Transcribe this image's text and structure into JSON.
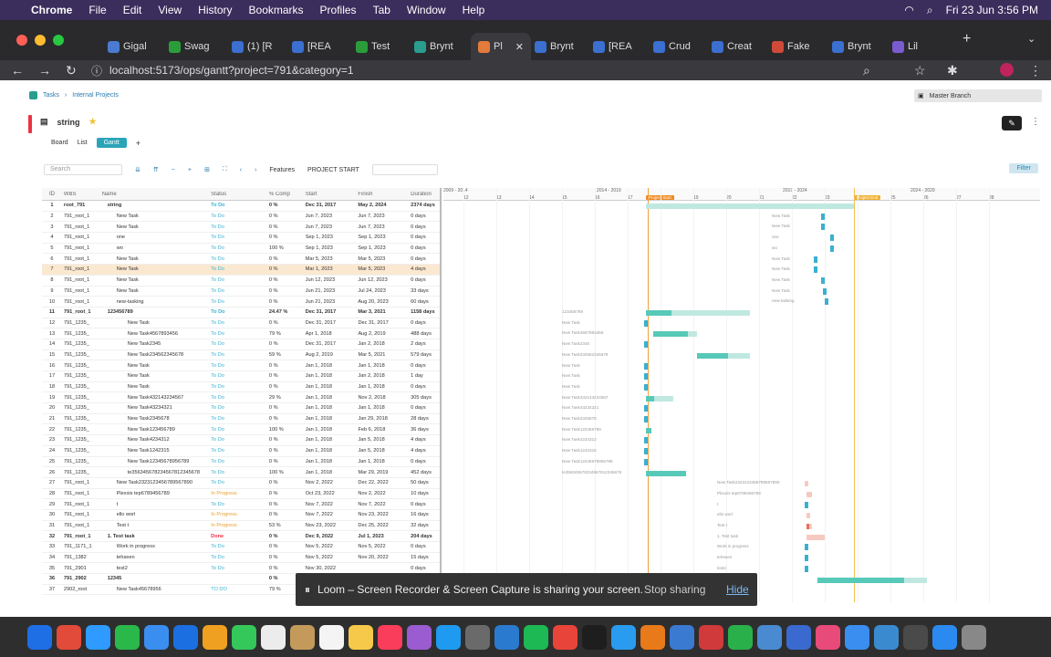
{
  "menubar": {
    "app": "Chrome",
    "menus": [
      "File",
      "Edit",
      "View",
      "History",
      "Bookmarks",
      "Profiles",
      "Tab",
      "Window",
      "Help"
    ],
    "clock": "Fri 23 Jun  3:56 PM"
  },
  "tabs": [
    {
      "label": "Gigal",
      "color": "#4a7bd0"
    },
    {
      "label": "Swag",
      "color": "#2a9d3a"
    },
    {
      "label": "(1) [R",
      "color": "#3b6fd0"
    },
    {
      "label": "[REA",
      "color": "#3b6fd0"
    },
    {
      "label": "Test",
      "color": "#2a9d3a"
    },
    {
      "label": "Brynt",
      "color": "#2a9d8f"
    },
    {
      "label": "Pl",
      "color": "#e37b3a",
      "active": true
    },
    {
      "label": "Brynt",
      "color": "#3b6fd0"
    },
    {
      "label": "[REA",
      "color": "#3b6fd0"
    },
    {
      "label": "Crud",
      "color": "#3b6fd0"
    },
    {
      "label": "Creat",
      "color": "#3b6fd0"
    },
    {
      "label": "Fake",
      "color": "#d04a3a"
    },
    {
      "label": "Brynt",
      "color": "#3b6fd0"
    },
    {
      "label": "Lil",
      "color": "#7a5cd0"
    }
  ],
  "address": {
    "url": "localhost:5173/ops/gantt?project=791&category=1"
  },
  "breadcrumb": {
    "root": "Tasks",
    "current": "Internal Projects"
  },
  "branch": "Master Branch",
  "project": {
    "title": "string"
  },
  "views": {
    "board": "Board",
    "list": "List",
    "gantt": "Gantt"
  },
  "toolbar": {
    "search_placeholder": "Search",
    "features": "Features",
    "project_start": "PROJECT START",
    "filter": "Filter"
  },
  "columns": {
    "id": "ID",
    "wbs": "WBS",
    "name": "Name",
    "status": "Status",
    "comp": "% Comp",
    "start": "Start",
    "finish": "Finish",
    "duration": "Duration"
  },
  "timeline": {
    "groups": [
      "2009 - 2014",
      "2014 - 2019",
      "2019 - 2024",
      "2024 - 2029"
    ],
    "ticks": [
      "12",
      "13",
      "14",
      "15",
      "16",
      "17",
      "18",
      "19",
      "20",
      "21",
      "22",
      "23",
      "24",
      "25",
      "26",
      "27",
      "28"
    ],
    "project_start_tag": "Project Start",
    "project_end_tag": "Project End"
  },
  "rows": [
    [
      "1",
      "root_791",
      "string",
      "To Do",
      "0 %",
      "Dec 31, 2017",
      "May 2, 2024",
      "2374 days"
    ],
    [
      "2",
      "791_root_1",
      "New Task",
      "To Do",
      "0 %",
      "Jun 7, 2023",
      "Jun 7, 2023",
      "0 days"
    ],
    [
      "3",
      "791_root_1",
      "New Task",
      "To Do",
      "0 %",
      "Jun 7, 2023",
      "Jun 7, 2023",
      "0 days"
    ],
    [
      "4",
      "791_root_1",
      "one",
      "To Do",
      "0 %",
      "Sep 1, 2023",
      "Sep 1, 2023",
      "0 days"
    ],
    [
      "5",
      "791_root_1",
      "wo",
      "To Do",
      "100 %",
      "Sep 1, 2023",
      "Sep 1, 2023",
      "0 days"
    ],
    [
      "6",
      "791_root_1",
      "New Task",
      "To Do",
      "0 %",
      "Mar 5, 2023",
      "Mar 5, 2023",
      "0 days"
    ],
    [
      "7",
      "791_root_1",
      "New Task",
      "To Do",
      "0 %",
      "Mar 1, 2023",
      "Mar 5, 2023",
      "4 days"
    ],
    [
      "8",
      "791_root_1",
      "New Task",
      "To Do",
      "0 %",
      "Jun 12, 2023",
      "Jun 12, 2023",
      "0 days"
    ],
    [
      "9",
      "791_root_1",
      "New Task",
      "To Do",
      "0 %",
      "Jun 21, 2023",
      "Jul 24, 2023",
      "33 days"
    ],
    [
      "10",
      "791_root_1",
      "new-tasking",
      "To Do",
      "0 %",
      "Jun 21, 2023",
      "Aug 20, 2023",
      "60 days"
    ],
    [
      "11",
      "791_root_1",
      "123456789",
      "To Do",
      "24.47 %",
      "Dec 31, 2017",
      "Mar 3, 2021",
      "1158 days"
    ],
    [
      "12",
      "791_1235_",
      "New Task",
      "To Do",
      "0 %",
      "Dec 31, 2017",
      "Dec 31, 2017",
      "0 days"
    ],
    [
      "13",
      "791_1235_",
      "New Task4567893456",
      "To Do",
      "79 %",
      "Apr 1, 2018",
      "Aug 2, 2019",
      "488 days"
    ],
    [
      "14",
      "791_1235_",
      "New Task2345",
      "To Do",
      "0 %",
      "Dec 31, 2017",
      "Jan 2, 2018",
      "2 days"
    ],
    [
      "15",
      "791_1235_",
      "New Task234562345678",
      "To Do",
      "59 %",
      "Aug 2, 2019",
      "Mar 5, 2021",
      "579 days"
    ],
    [
      "16",
      "791_1235_",
      "New Task",
      "To Do",
      "0 %",
      "Jan 1, 2018",
      "Jan 1, 2018",
      "0 days"
    ],
    [
      "17",
      "791_1235_",
      "New Task",
      "To Do",
      "0 %",
      "Jan 1, 2018",
      "Jan 2, 2018",
      "1 day"
    ],
    [
      "18",
      "791_1235_",
      "New Task",
      "To Do",
      "0 %",
      "Jan 1, 2018",
      "Jan 1, 2018",
      "0 days"
    ],
    [
      "19",
      "791_1235_",
      "New Task432143234567",
      "To Do",
      "29 %",
      "Jan 1, 2018",
      "Nov 2, 2018",
      "305 days"
    ],
    [
      "20",
      "791_1235_",
      "New Task43234321",
      "To Do",
      "0 %",
      "Jan 1, 2018",
      "Jan 1, 2018",
      "0 days"
    ],
    [
      "21",
      "791_1235_",
      "New Task2345678",
      "To Do",
      "0 %",
      "Jan 1, 2018",
      "Jan 29, 2018",
      "28 days"
    ],
    [
      "22",
      "791_1235_",
      "New Task123456789",
      "To Do",
      "100 %",
      "Jan 1, 2018",
      "Feb 6, 2018",
      "36 days"
    ],
    [
      "23",
      "791_1235_",
      "New Task4234312",
      "To Do",
      "0 %",
      "Jan 1, 2018",
      "Jan 5, 2018",
      "4 days"
    ],
    [
      "24",
      "791_1235_",
      "New Task1242315",
      "To Do",
      "0 %",
      "Jan 1, 2018",
      "Jan 5, 2018",
      "4 days"
    ],
    [
      "25",
      "791_1235_",
      "New Task12345678956789",
      "To Do",
      "0 %",
      "Jan 1, 2018",
      "Jan 1, 2018",
      "0 days"
    ],
    [
      "26",
      "791_1235_",
      "te356345678234567812345678",
      "To Do",
      "100 %",
      "Jan 1, 2018",
      "Mar 29, 2019",
      "452 days"
    ],
    [
      "27",
      "791_root_1",
      "New Task2323123456789567890",
      "To Do",
      "0 %",
      "Nov 2, 2022",
      "Dec 22, 2022",
      "50 days"
    ],
    [
      "28",
      "791_root_1",
      "Plexxis tep6789456789",
      "In Progress",
      "0 %",
      "Oct 23, 2022",
      "Nov 2, 2022",
      "10 days"
    ],
    [
      "29",
      "791_root_1",
      "t",
      "To Do",
      "0 %",
      "Nov 7, 2022",
      "Nov 7, 2022",
      "0 days"
    ],
    [
      "30",
      "791_root_1",
      "ello worl",
      "In Progress",
      "0 %",
      "Nov 7, 2022",
      "Nov 23, 2022",
      "16 days"
    ],
    [
      "31",
      "791_root_1",
      "Test t",
      "In Progress",
      "53 %",
      "Nov 23, 2022",
      "Dec 25, 2022",
      "32 days"
    ],
    [
      "32",
      "791_root_1",
      "1. Test task",
      "Done",
      "0 %",
      "Dec 9, 2022",
      "Jul 1, 2023",
      "204 days"
    ],
    [
      "33",
      "791_1171_1",
      "Work in progress",
      "To Do",
      "0 %",
      "Nov 5, 2022",
      "Nov 5, 2022",
      "0 days"
    ],
    [
      "34",
      "791_1382",
      "tehseen",
      "To Do",
      "0 %",
      "Nov 5, 2022",
      "Nov 20, 2022",
      "15 days"
    ],
    [
      "35",
      "791_2901",
      "test2",
      "To Do",
      "0 %",
      "Nov 30, 2022",
      "",
      "0 days"
    ],
    [
      "36",
      "791_2902",
      "12345",
      "",
      "0 %",
      "",
      "",
      ""
    ],
    [
      "37",
      "2902_root",
      "New Task45678956",
      "TO DO",
      "79 %",
      "",
      "",
      ""
    ]
  ],
  "loom": {
    "message": "Loom – Screen Recorder & Screen Capture is sharing your screen.",
    "stop": "Stop sharing",
    "hide": "Hide"
  },
  "dock": [
    "#1e6ee6",
    "#e24a3a",
    "#2f9aff",
    "#2ab84a",
    "#3a8ef0",
    "#1c6fe0",
    "#f0a020",
    "#34c759",
    "#ececec",
    "#c49a5a",
    "#f4f4f4",
    "#f6c94a",
    "#fa3d5a",
    "#9a5cd0",
    "#1e9af0",
    "#6a6a6a",
    "#2a7ad0",
    "#1db954",
    "#e8443a",
    "#1e1e1e",
    "#2a9cf0",
    "#e87a1a",
    "#3a7ad0",
    "#d03a3a",
    "#2ab04a",
    "#4a8ad0",
    "#3a6ad0",
    "#e84a7a",
    "#3a8ef0",
    "#3a8ad0",
    "#4a4a4a",
    "#2a8af0",
    "#888"
  ]
}
